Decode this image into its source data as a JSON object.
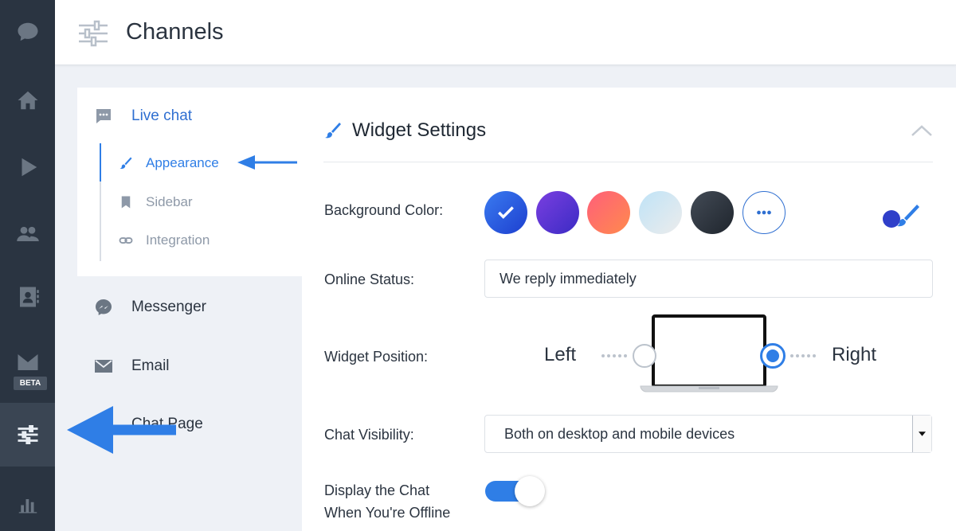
{
  "header": {
    "title": "Channels"
  },
  "rail": {
    "beta_badge": "BETA"
  },
  "subnav": {
    "live_chat": "Live chat",
    "sub_items": [
      {
        "label": "Appearance"
      },
      {
        "label": "Sidebar"
      },
      {
        "label": "Integration"
      }
    ],
    "messenger": "Messenger",
    "email": "Email",
    "chat_page": "Chat Page"
  },
  "panel": {
    "title": "Widget Settings",
    "background_color_label": "Background Color:",
    "online_status_label": "Online Status:",
    "online_status_value": "We reply immediately",
    "widget_position_label": "Widget Position:",
    "position_left": "Left",
    "position_right": "Right",
    "chat_visibility_label": "Chat Visibility:",
    "chat_visibility_value": "Both on desktop and mobile devices",
    "offline_label_line1": "Display the Chat",
    "offline_label_line2": "When You're Offline"
  },
  "colors": {
    "accent": "#2f7ee6",
    "rail_bg": "#2a3441",
    "swatches": [
      "#1e5fe0",
      "#5b32d6",
      "#ff6a6a",
      "#cfe6f5",
      "#2e3540"
    ]
  }
}
